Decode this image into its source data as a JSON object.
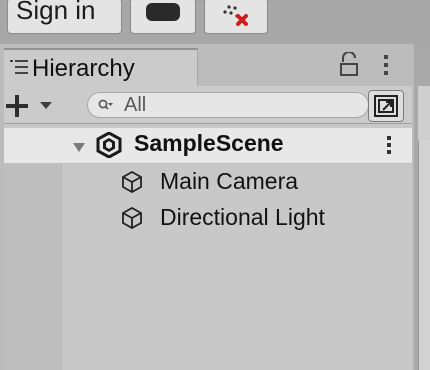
{
  "toolbar": {
    "signin_label": "Sign in"
  },
  "hierarchy": {
    "tab_label": "Hierarchy",
    "search": {
      "value": "All",
      "placeholder": "All"
    },
    "scene": {
      "name": "SampleScene"
    },
    "items": [
      {
        "label": "Main Camera"
      },
      {
        "label": "Directional Light"
      }
    ]
  },
  "icons": {
    "tab": "list-icon",
    "lock": "lock-icon",
    "menu": "kebab-menu-icon",
    "add": "plus-dropdown-icon",
    "search": "search-filter-icon",
    "scene_toggle": "scene-visibility-icon",
    "scene": "unity-scene-icon",
    "gameobject": "cube-icon"
  }
}
